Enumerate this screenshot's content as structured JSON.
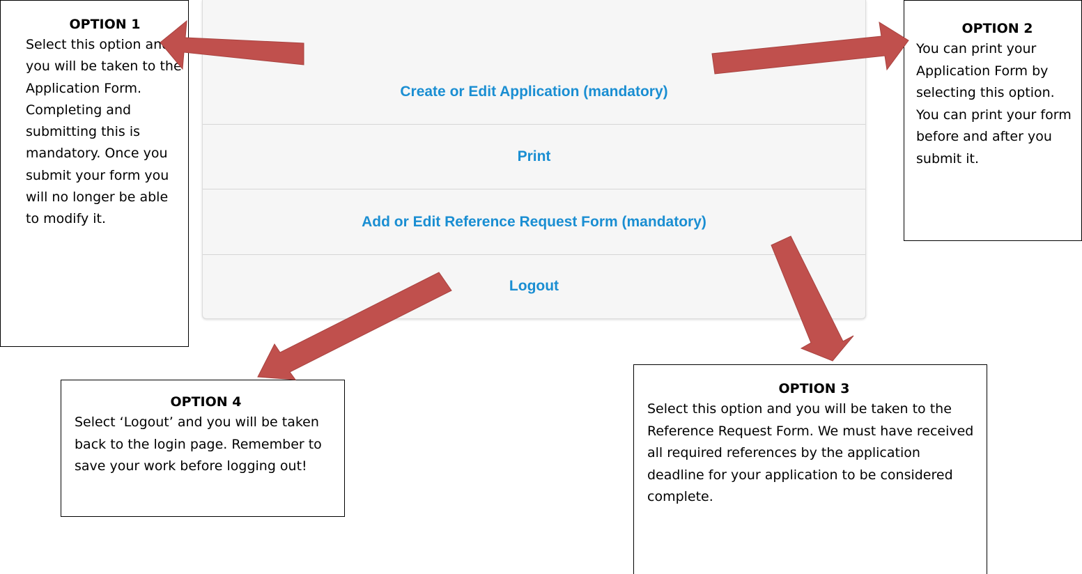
{
  "menu": {
    "items": [
      {
        "label": "Create or Edit Application (mandatory)"
      },
      {
        "label": "Print"
      },
      {
        "label": "Add or Edit Reference Request Form (mandatory)"
      },
      {
        "label": "Logout"
      }
    ],
    "link_color": "#1a8ed2"
  },
  "callouts": {
    "option1": {
      "title": "OPTION 1",
      "body": "Select this option and you will be taken to the Application Form. Completing and submitting this is mandatory. Once you submit your form you will no longer be able to modify it."
    },
    "option2": {
      "title": "OPTION 2",
      "body": "You can print your Application Form by selecting this option. You can print your form before and after you submit it."
    },
    "option3": {
      "title": "OPTION 3",
      "body": "Select this option and you will be taken to the Reference Request Form. We must have received all required references by the application deadline for your application to be considered complete."
    },
    "option4": {
      "title": "OPTION 4",
      "body": "Select ‘Logout’ and you will be taken back to the login page. Remember to save your work before logging out!"
    }
  },
  "arrow_color": "#c0504d"
}
